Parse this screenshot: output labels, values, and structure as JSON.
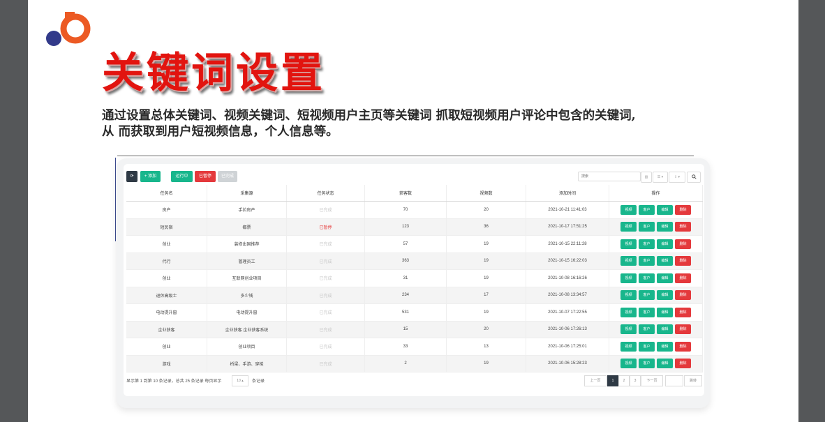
{
  "slide": {
    "title": "关键词设置",
    "desc_line1": "通过设置总体关键词、视频关键词、短视频用户主页等关键词 抓取短视频用户评论中包含的关键词,",
    "desc_line2": "从 而获取到用户短视频信息，个人信息等。"
  },
  "colors": {
    "title_red": "#e2140f",
    "logo_orange": "#ec5a24",
    "logo_navy": "#323a8a",
    "btn_green": "#18b68c",
    "btn_red": "#e4393c",
    "btn_grey": "#cfd3d6",
    "btn_dark": "#2f3a45"
  },
  "toolbar": {
    "refresh_icon": "refresh-icon",
    "add_label": "+ 添加",
    "running_label": "运行中",
    "paused_label": "已暂停",
    "done_label": "已完成",
    "search_placeholder": "搜索",
    "view_label": "▥",
    "columns_label": "☰ ▾",
    "export_label": "⇩ ▾",
    "search_icon_label": "🔍"
  },
  "table": {
    "headers": [
      "任务名",
      "采集源",
      "任务状态",
      "获客数",
      "视频数",
      "添加时间",
      "操作"
    ],
    "ops": [
      "视频",
      "客户",
      "编辑",
      "删除"
    ],
    "rows": [
      [
        "房产",
        "手拉房产",
        "已完成",
        "70",
        "20",
        "2021-10-21 11:41:03"
      ],
      [
        "短民宿",
        "都票",
        "已暂停",
        "123",
        "36",
        "2021-10-17 17:51:25"
      ],
      [
        "创业",
        "装修出国推荐",
        "已完成",
        "57",
        "19",
        "2021-10-15 22:11:28"
      ],
      [
        "代行",
        "管理员工",
        "已完成",
        "363",
        "19",
        "2021-10-15 16:22:03"
      ],
      [
        "创业",
        "互联网创业项目",
        "已完成",
        "31",
        "19",
        "2021-10-08 16:16:26"
      ],
      [
        "退休高级士",
        "多少钱",
        "已完成",
        "234",
        "17",
        "2021-10-08 13:34:57"
      ],
      [
        "电动提升窗",
        "电动提升窗",
        "已完成",
        "531",
        "19",
        "2021-10-07 17:22:55"
      ],
      [
        "企业获客",
        "企业获客 企业获客系统",
        "已完成",
        "15",
        "20",
        "2021-10-06 17:26:13"
      ],
      [
        "创业",
        "创业项目",
        "已完成",
        "33",
        "13",
        "2021-10-06 17:25:01"
      ],
      [
        "游戏",
        "桥梁、手游、穿梭",
        "已完成",
        "2",
        "19",
        "2021-10-06 15:28:23"
      ]
    ]
  },
  "footer": {
    "summary": "显示第 1 到第 10 条记录，总共 25 条记录 每页显示",
    "page_size": "10 ▴",
    "records_suffix": "条记录",
    "prev": "上一页",
    "pages": [
      "1",
      "2",
      "3"
    ],
    "next": "下一页",
    "goto_label": "跳转"
  }
}
